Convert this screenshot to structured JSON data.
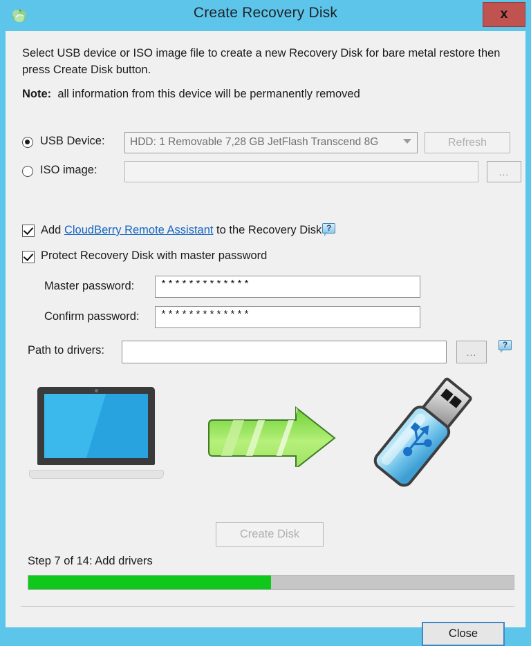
{
  "window": {
    "title": "Create Recovery Disk",
    "icon": "cloudberry-logo-icon",
    "close_label": "x",
    "titlebar_color": "#5ec5ea",
    "close_button_color": "#c0534f"
  },
  "content": {
    "intro": "Select USB device or ISO image file to create a new Recovery Disk for bare metal restore then press Create Disk button.",
    "note_label": "Note:",
    "note_text": "all information from this device will be permanently removed"
  },
  "source": {
    "usb_radio_label": "USB Device:",
    "usb_radio_selected": true,
    "usb_device_value": "HDD: 1 Removable 7,28 GB JetFlash Transcend 8G",
    "refresh_label": "Refresh",
    "refresh_disabled": true,
    "iso_radio_label": "ISO image:",
    "iso_radio_selected": false,
    "iso_value": "",
    "iso_browse_label": "..."
  },
  "options": {
    "add_assistant_checked": true,
    "add_assistant_prefix": "Add ",
    "add_assistant_link": "CloudBerry Remote Assistant",
    "add_assistant_suffix": " to the Recovery Disk",
    "protect_checked": true,
    "protect_label": "Protect Recovery Disk with master password",
    "master_password_label": "Master password:",
    "master_password_value": "*************",
    "confirm_password_label": "Confirm password:",
    "confirm_password_value": "*************"
  },
  "drivers": {
    "label": "Path to drivers:",
    "value": "",
    "browse_label": "..."
  },
  "illustration": {
    "source_device": "laptop-icon",
    "arrow": "green-right-arrow-icon",
    "target_device": "usb-flash-drive-icon"
  },
  "actions": {
    "create_disk_label": "Create Disk",
    "create_disk_disabled": true,
    "close_label": "Close"
  },
  "progress": {
    "step_text": "Step 7 of 14: Add drivers",
    "current_step": 7,
    "total_steps": 14,
    "percent": 50,
    "fill_color": "#10c81b",
    "track_color": "#c6c6c6"
  }
}
